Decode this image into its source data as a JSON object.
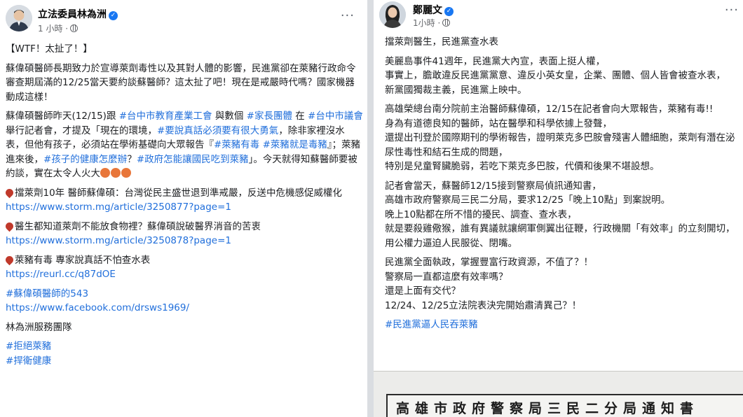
{
  "left_post": {
    "author": "立法委員林為洲",
    "time": "1 小時 ·",
    "more": "···",
    "paragraphs": [
      [
        {
          "t": "text",
          "v": "【WTF！太扯了！】"
        }
      ],
      [
        {
          "t": "text",
          "v": "蘇偉碩醫師長期致力於宣導萊劑毒性以及其對人體的影響，民進黨卻在萊豬行政命令審查期屆滿的12/25當天要約談蘇醫師？這太扯了吧！現在是戒嚴時代嗎？國家機器動成這樣！"
        }
      ],
      [
        {
          "t": "text",
          "v": "蘇偉碩醫師昨天(12/15)跟 "
        },
        {
          "t": "tag",
          "v": "#台中市教育產業工會"
        },
        {
          "t": "text",
          "v": " 與數個 "
        },
        {
          "t": "tag",
          "v": "#家長團體"
        },
        {
          "t": "text",
          "v": " 在 "
        },
        {
          "t": "tag",
          "v": "#台中市議會"
        },
        {
          "t": "text",
          "v": " 舉行記者會，才提及「現在的環境，"
        },
        {
          "t": "tag",
          "v": "#要說真話必須要有很大勇氣"
        },
        {
          "t": "text",
          "v": "，除非家裡沒水表，但他有孩子，必須站在學術基礎向大眾報告『"
        },
        {
          "t": "tag",
          "v": "#萊豬有毒"
        },
        {
          "t": "text",
          "v": " "
        },
        {
          "t": "tag",
          "v": "#萊豬就是毒豬"
        },
        {
          "t": "text",
          "v": "』；萊豬進來後，"
        },
        {
          "t": "tag",
          "v": "#孩子的健康怎麼辦"
        },
        {
          "t": "text",
          "v": "？"
        },
        {
          "t": "tag",
          "v": "#政府怎能讓國民吃到萊豬"
        },
        {
          "t": "text",
          "v": "」。今天就得知蘇醫師要被約談，實在太令人火大"
        },
        {
          "t": "faces",
          "v": "3"
        }
      ],
      [
        {
          "t": "pin",
          "v": ""
        },
        {
          "t": "text",
          "v": "擋萊劑10年 醫師蘇偉碩：台灣從民主盛世退到準戒嚴，反送中危機感促威權化"
        },
        {
          "t": "br",
          "v": ""
        },
        {
          "t": "link",
          "v": "https://www.storm.mg/article/3250877?page=1"
        }
      ],
      [
        {
          "t": "pin",
          "v": ""
        },
        {
          "t": "text",
          "v": "醫生都知道萊劑不能放食物裡？蘇偉碩說破醫界消音的苦衷"
        },
        {
          "t": "br",
          "v": ""
        },
        {
          "t": "link",
          "v": "https://www.storm.mg/article/3250878?page=1"
        }
      ],
      [
        {
          "t": "pin",
          "v": ""
        },
        {
          "t": "text",
          "v": "萊豬有毒 專家說真話不怕查水表"
        },
        {
          "t": "br",
          "v": ""
        },
        {
          "t": "link",
          "v": "https://reurl.cc/q87dOE"
        }
      ],
      [
        {
          "t": "tag",
          "v": "#蘇偉碩醫師的543"
        },
        {
          "t": "br",
          "v": ""
        },
        {
          "t": "link",
          "v": "https://www.facebook.com/drsws1969/"
        }
      ],
      [
        {
          "t": "text",
          "v": "林為洲服務團隊"
        }
      ],
      [
        {
          "t": "tag",
          "v": "#拒絕萊豬"
        },
        {
          "t": "br",
          "v": ""
        },
        {
          "t": "tag",
          "v": "#捍衛健康"
        }
      ]
    ]
  },
  "right_post": {
    "author": "鄭麗文",
    "time": "1小時 ·",
    "more": "···",
    "paragraphs": [
      [
        {
          "t": "text",
          "v": "擋萊劑醫生，民進黨查水表"
        }
      ],
      [
        {
          "t": "text",
          "v": "美麗島事件41週年，民進黨大內宣，表面上挺人權，\n事實上，膽敢違反民進黨黨意、違反小英女皇，企業、團體、個人皆會被查水表，\n新黨國獨裁主義，民進黨上映中。"
        }
      ],
      [
        {
          "t": "text",
          "v": "高雄榮總台南分院前主治醫師蘇偉碩，12/15在記者會向大眾報告，萊豬有毒!!\n身為有道德良知的醫師，站在醫學和科學依據上發聲，\n還提出刊登於國際期刊的學術報告，證明萊克多巴胺會殘害人體細胞，萊劑有潛在泌尿性毒性和結石生成的問題，\n特別是兒童腎臟脆弱，若吃下萊克多巴胺，代價和後果不堪設想。"
        }
      ],
      [
        {
          "t": "text",
          "v": "記者會當天，蘇醫師12/15接到警察局偵訊通知書，\n高雄市政府警察局三民二分局，要求12/25「晚上10點」到案說明。\n晚上10點都在所不惜的擾民、調查、查水表，\n就是要殺雞儆猴，誰有異議就讓網軍側翼出征鞭，行政機關「有效率」的立刻開切，用公權力逼迫人民服從、閉嘴。"
        }
      ],
      [
        {
          "t": "text",
          "v": "民進黨全面執政，掌握豐富行政資源，不值了？！\n警察局一直都這麼有效率嗎？\n還是上面有交代？\n12/24、12/25立法院表決完開始肅清異己？！"
        }
      ],
      [
        {
          "t": "tag",
          "v": "#民進黨逼人民吞萊豬"
        }
      ]
    ]
  },
  "notice": {
    "title": "高雄市政府警察局三民二分局通知書"
  },
  "colors": {
    "link": "#216fdb",
    "verified": "#1877f2",
    "meta": "#65676b"
  }
}
